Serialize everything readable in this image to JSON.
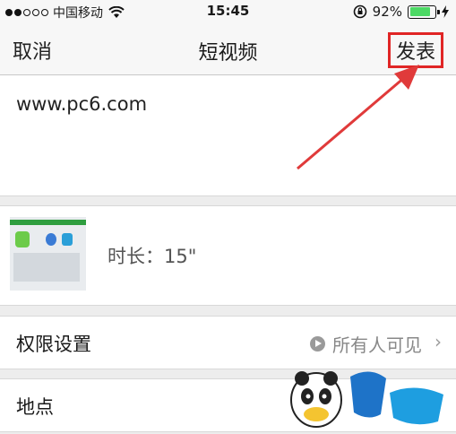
{
  "status_bar": {
    "carrier": "中国移动",
    "time": "15:45",
    "battery_percent": "92%",
    "battery_level": 0.92,
    "signal_dots_filled": 2,
    "signal_dots_total": 5
  },
  "nav": {
    "cancel_label": "取消",
    "title": "短视频",
    "publish_label": "发表"
  },
  "post": {
    "text": "www.pc6.com"
  },
  "video": {
    "duration_text": "时长：15\""
  },
  "permission": {
    "label": "权限设置",
    "value": "所有人可见"
  },
  "location": {
    "label": "地点"
  },
  "colors": {
    "highlight_box": "#e02525",
    "arrow": "#e03a3a",
    "battery_fill": "#4cd964"
  }
}
